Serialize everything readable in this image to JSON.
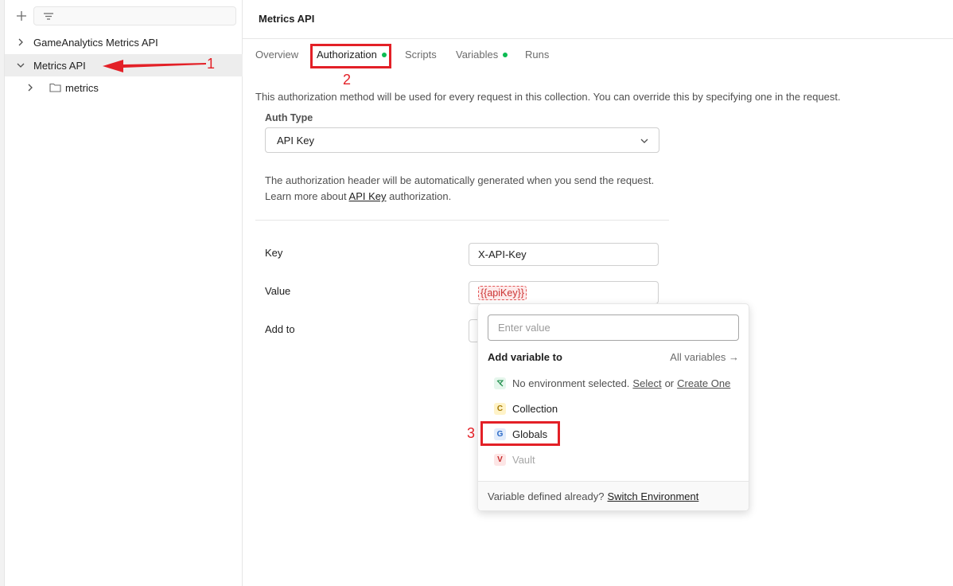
{
  "sidebar": {
    "new_icon": "plus-icon",
    "filter_icon": "filter-icon",
    "items": [
      {
        "label": "GameAnalytics Metrics API",
        "expanded": false
      },
      {
        "label": "Metrics API",
        "expanded": true
      },
      {
        "label": "metrics",
        "expanded": false,
        "icon": "folder-icon"
      }
    ]
  },
  "main": {
    "title": "Metrics API",
    "tabs": [
      {
        "label": "Overview",
        "dot": false
      },
      {
        "label": "Authorization",
        "dot": true,
        "active": true
      },
      {
        "label": "Scripts",
        "dot": false
      },
      {
        "label": "Variables",
        "dot": true
      },
      {
        "label": "Runs",
        "dot": false
      }
    ],
    "description": "This authorization method will be used for every request in this collection. You can override this by specifying one in the request.",
    "auth_type_label": "Auth Type",
    "auth_type_value": "API Key",
    "note_line1": "The authorization header will be automatically generated when you send the request.",
    "note_line2_prefix": "Learn more about",
    "note_line2_link": "API Key",
    "note_line2_suffix": "authorization.",
    "fields": {
      "key_label": "Key",
      "key_value": "X-API-Key",
      "value_label": "Value",
      "value_value": "{{apiKey}}",
      "addto_label": "Add to"
    }
  },
  "popup": {
    "input_placeholder": "Enter value",
    "heading": "Add variable to",
    "all_variables": "All variables →",
    "no_env_text": "No environment selected.",
    "select_link": "Select",
    "or_text": "or",
    "create_link": "Create One",
    "collection_badge": "C",
    "collection_label": "Collection",
    "globals_badge": "G",
    "globals_label": "Globals",
    "vault_badge": "V",
    "vault_label": "Vault",
    "footer_text": "Variable defined already?",
    "footer_link": "Switch Environment"
  },
  "annotations": {
    "a1": "1",
    "a2": "2",
    "a3": "3"
  },
  "colors": {
    "annotation": "#e32027",
    "dot": "#0cbb52"
  }
}
